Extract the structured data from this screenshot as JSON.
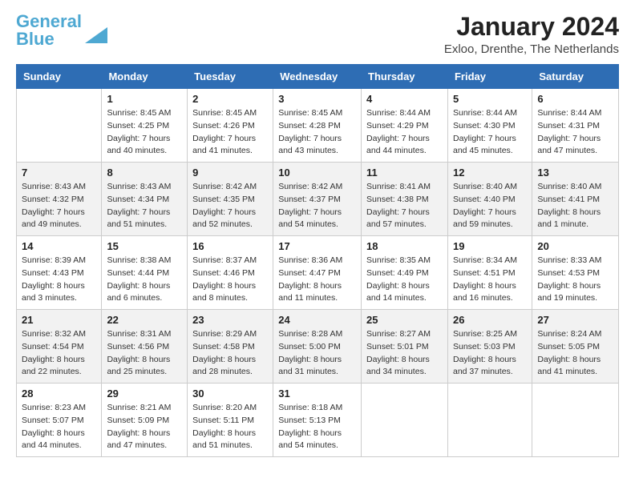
{
  "logo": {
    "line1": "General",
    "line2": "Blue"
  },
  "title": "January 2024",
  "location": "Exloo, Drenthe, The Netherlands",
  "weekdays": [
    "Sunday",
    "Monday",
    "Tuesday",
    "Wednesday",
    "Thursday",
    "Friday",
    "Saturday"
  ],
  "weeks": [
    [
      {
        "day": "",
        "info": ""
      },
      {
        "day": "1",
        "info": "Sunrise: 8:45 AM\nSunset: 4:25 PM\nDaylight: 7 hours\nand 40 minutes."
      },
      {
        "day": "2",
        "info": "Sunrise: 8:45 AM\nSunset: 4:26 PM\nDaylight: 7 hours\nand 41 minutes."
      },
      {
        "day": "3",
        "info": "Sunrise: 8:45 AM\nSunset: 4:28 PM\nDaylight: 7 hours\nand 43 minutes."
      },
      {
        "day": "4",
        "info": "Sunrise: 8:44 AM\nSunset: 4:29 PM\nDaylight: 7 hours\nand 44 minutes."
      },
      {
        "day": "5",
        "info": "Sunrise: 8:44 AM\nSunset: 4:30 PM\nDaylight: 7 hours\nand 45 minutes."
      },
      {
        "day": "6",
        "info": "Sunrise: 8:44 AM\nSunset: 4:31 PM\nDaylight: 7 hours\nand 47 minutes."
      }
    ],
    [
      {
        "day": "7",
        "info": "Sunrise: 8:43 AM\nSunset: 4:32 PM\nDaylight: 7 hours\nand 49 minutes."
      },
      {
        "day": "8",
        "info": "Sunrise: 8:43 AM\nSunset: 4:34 PM\nDaylight: 7 hours\nand 51 minutes."
      },
      {
        "day": "9",
        "info": "Sunrise: 8:42 AM\nSunset: 4:35 PM\nDaylight: 7 hours\nand 52 minutes."
      },
      {
        "day": "10",
        "info": "Sunrise: 8:42 AM\nSunset: 4:37 PM\nDaylight: 7 hours\nand 54 minutes."
      },
      {
        "day": "11",
        "info": "Sunrise: 8:41 AM\nSunset: 4:38 PM\nDaylight: 7 hours\nand 57 minutes."
      },
      {
        "day": "12",
        "info": "Sunrise: 8:40 AM\nSunset: 4:40 PM\nDaylight: 7 hours\nand 59 minutes."
      },
      {
        "day": "13",
        "info": "Sunrise: 8:40 AM\nSunset: 4:41 PM\nDaylight: 8 hours\nand 1 minute."
      }
    ],
    [
      {
        "day": "14",
        "info": "Sunrise: 8:39 AM\nSunset: 4:43 PM\nDaylight: 8 hours\nand 3 minutes."
      },
      {
        "day": "15",
        "info": "Sunrise: 8:38 AM\nSunset: 4:44 PM\nDaylight: 8 hours\nand 6 minutes."
      },
      {
        "day": "16",
        "info": "Sunrise: 8:37 AM\nSunset: 4:46 PM\nDaylight: 8 hours\nand 8 minutes."
      },
      {
        "day": "17",
        "info": "Sunrise: 8:36 AM\nSunset: 4:47 PM\nDaylight: 8 hours\nand 11 minutes."
      },
      {
        "day": "18",
        "info": "Sunrise: 8:35 AM\nSunset: 4:49 PM\nDaylight: 8 hours\nand 14 minutes."
      },
      {
        "day": "19",
        "info": "Sunrise: 8:34 AM\nSunset: 4:51 PM\nDaylight: 8 hours\nand 16 minutes."
      },
      {
        "day": "20",
        "info": "Sunrise: 8:33 AM\nSunset: 4:53 PM\nDaylight: 8 hours\nand 19 minutes."
      }
    ],
    [
      {
        "day": "21",
        "info": "Sunrise: 8:32 AM\nSunset: 4:54 PM\nDaylight: 8 hours\nand 22 minutes."
      },
      {
        "day": "22",
        "info": "Sunrise: 8:31 AM\nSunset: 4:56 PM\nDaylight: 8 hours\nand 25 minutes."
      },
      {
        "day": "23",
        "info": "Sunrise: 8:29 AM\nSunset: 4:58 PM\nDaylight: 8 hours\nand 28 minutes."
      },
      {
        "day": "24",
        "info": "Sunrise: 8:28 AM\nSunset: 5:00 PM\nDaylight: 8 hours\nand 31 minutes."
      },
      {
        "day": "25",
        "info": "Sunrise: 8:27 AM\nSunset: 5:01 PM\nDaylight: 8 hours\nand 34 minutes."
      },
      {
        "day": "26",
        "info": "Sunrise: 8:25 AM\nSunset: 5:03 PM\nDaylight: 8 hours\nand 37 minutes."
      },
      {
        "day": "27",
        "info": "Sunrise: 8:24 AM\nSunset: 5:05 PM\nDaylight: 8 hours\nand 41 minutes."
      }
    ],
    [
      {
        "day": "28",
        "info": "Sunrise: 8:23 AM\nSunset: 5:07 PM\nDaylight: 8 hours\nand 44 minutes."
      },
      {
        "day": "29",
        "info": "Sunrise: 8:21 AM\nSunset: 5:09 PM\nDaylight: 8 hours\nand 47 minutes."
      },
      {
        "day": "30",
        "info": "Sunrise: 8:20 AM\nSunset: 5:11 PM\nDaylight: 8 hours\nand 51 minutes."
      },
      {
        "day": "31",
        "info": "Sunrise: 8:18 AM\nSunset: 5:13 PM\nDaylight: 8 hours\nand 54 minutes."
      },
      {
        "day": "",
        "info": ""
      },
      {
        "day": "",
        "info": ""
      },
      {
        "day": "",
        "info": ""
      }
    ]
  ]
}
